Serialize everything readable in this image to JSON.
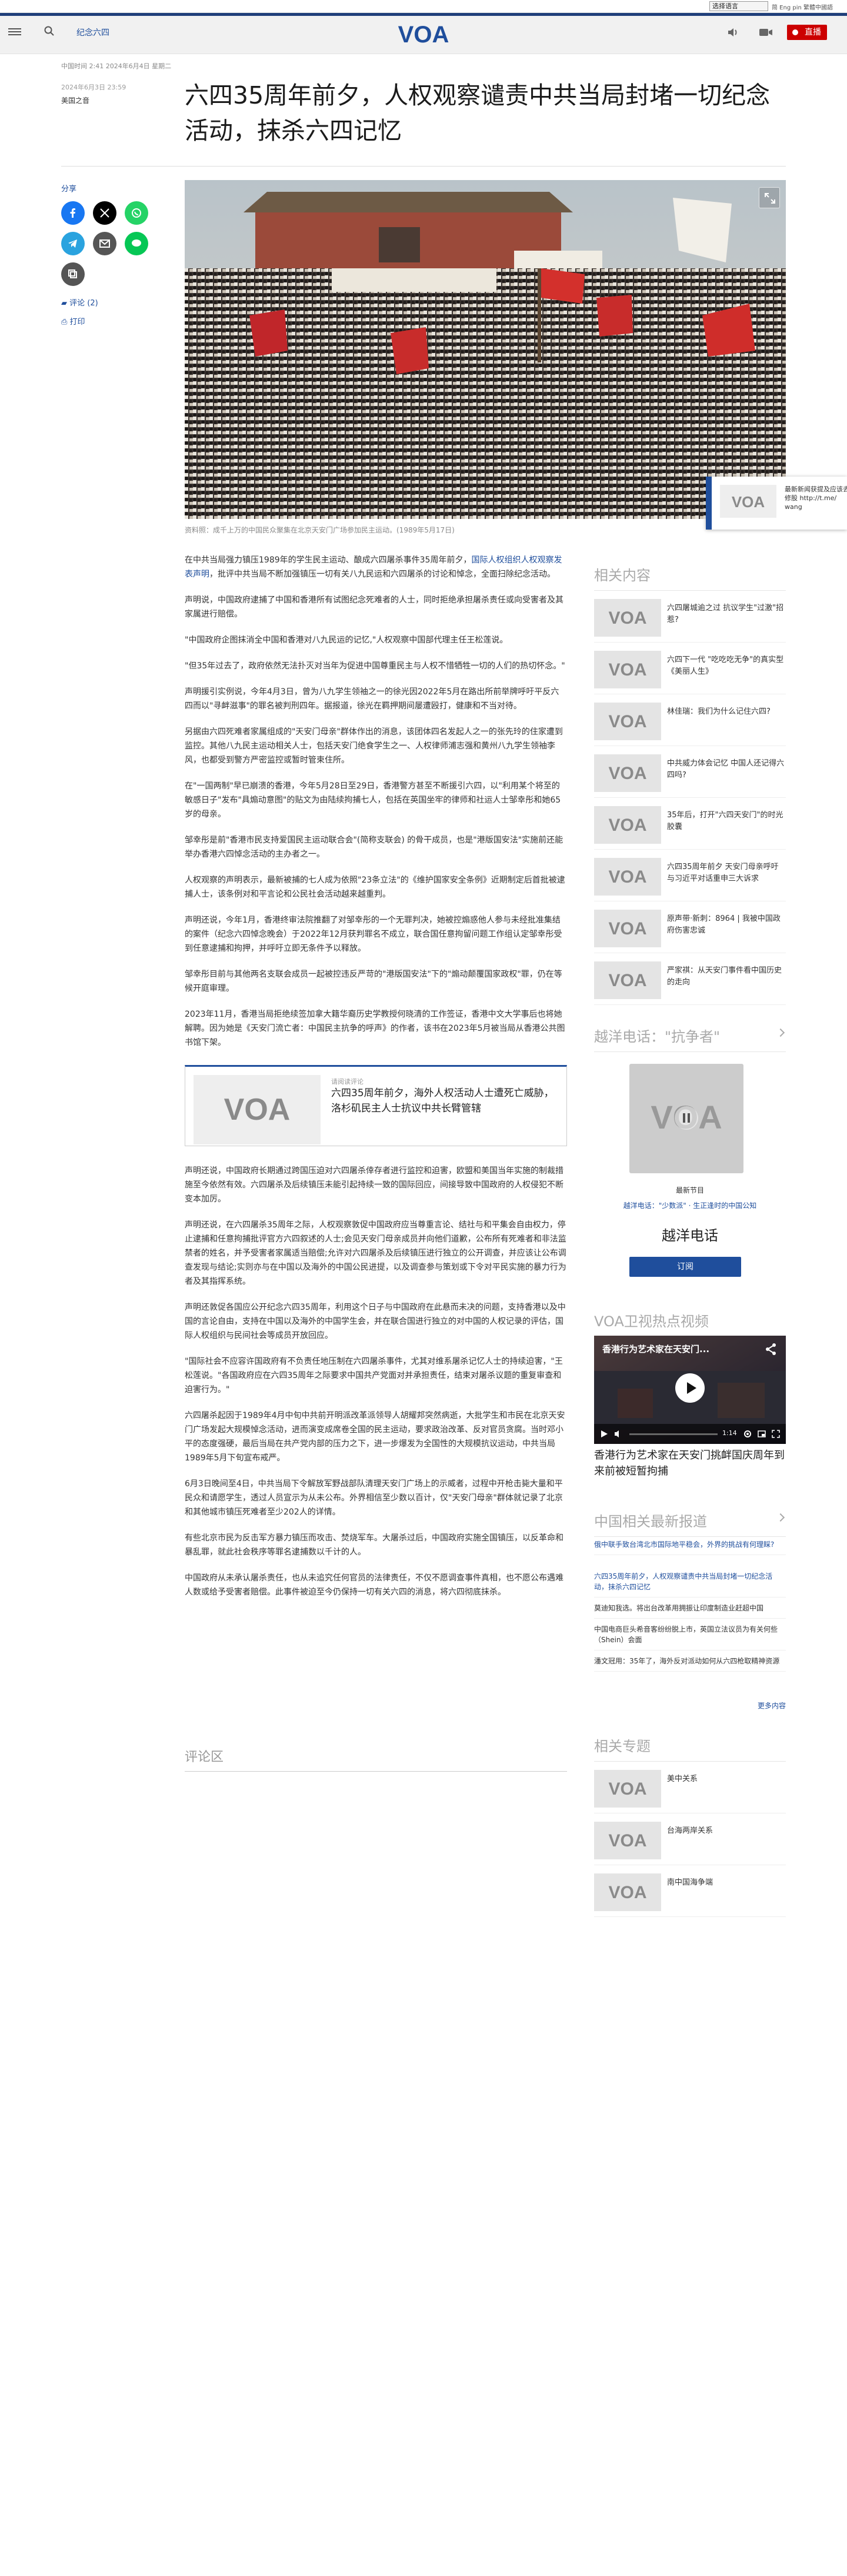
{
  "topbar": {
    "language_select": "选择语言",
    "links": "简 Eng pin  繁體中國語"
  },
  "nav": {
    "title": "纪念六四",
    "live_label": "直播",
    "logo_text": "VOA"
  },
  "article": {
    "meta": "中国时间 2:41 2024年6月4日 星期二",
    "date": "2024年6月3日 23:59",
    "category": "美国之音",
    "title": "六四35周年前夕，人权观察谴责中共当局封堵一切纪念活动，抹杀六四记忆",
    "share_label": "分享",
    "comments_label": "评论 (2)",
    "print_label": "打印",
    "caption": "资料照：成千上万的中国民众聚集在北京天安门广场参加民主运动。(1989年5月17日)",
    "p1_a": "在中共当局强力镇压1989年的学生民主运动、酿成六四屠杀事件35周年前夕，",
    "p1_link": "国际人权组织人权观察发表声明",
    "p1_b": "，批评中共当局不断加强镇压一切有关八九民运和六四屠杀的讨论和悼念，全面扫除纪念活动。",
    "p2": "声明说，中国政府逮捕了中国和香港所有试图纪念死难者的人士，同时拒绝承担屠杀责任或向受害者及其家属进行赔偿。",
    "p3": "\"中国政府企图抹消全中国和香港对八九民运的记忆,\"人权观察中国部代理主任王松莲说。",
    "p4": "\"但35年过去了，政府依然无法扑灭对当年为促进中国尊重民主与人权不惜牺牲一切的人们的热切怀念。\"",
    "p5": "声明援引实例说，今年4月3日，曾为八九学生领袖之一的徐光因2022年5月在路出所前举牌呼吁平反六四而以\"寻衅滋事\"的罪名被判刑四年。据报道，徐光在羁押期间屡遭殴打，健康和不当对待。",
    "p6": "另据由六四死难者家属组成的\"天安门母亲\"群体作出的消息，该团体四名发起人之一的张先玲的住家遭到监控。其他八九民主运动相关人士，包括天安门绝食学生之一、人权律师浦志强和黄州八九学生领袖李风，也都受到警方严密监控或暂时管束住所。",
    "p7": "在\"一国两制\"早已崩溃的香港，今年5月28日至29日，香港警方甚至不断援引六四，以\"利用某个将至的敏感日子\"发布\"具煽动意图\"的贴文为由陆续拘捕七人，包括在英国坐牢的律师和社运人士邹幸彤和她65岁的母亲。",
    "p8": "邹幸彤是前\"香港市民支持爱国民主运动联合会\"(简称支联会) 的骨干成员，也是\"港版国安法\"实施前还能举办香港六四悼念活动的主办者之一。",
    "p9": "人权观察的声明表示，最新被捕的七人成为依照\"23条立法\"的《维护国家安全条例》近期制定后首批被逮捕人士，该条例对和平言论和公民社会活动越来越重判。",
    "p10": "声明还说，今年1月，香港终审法院推翻了对邹幸彤的一个无罪判决，她被控煽惑他人参与未经批准集结的案件（纪念六四悼念晚会）于2022年12月获判罪名不成立，联合国任意拘留问题工作组认定邹幸彤受到任意逮捕和拘押，并呼吁立即无条件予以释放。",
    "p11": "邹幸彤目前与其他两名支联会成员一起被控违反严苛的\"港版国安法\"下的\"煽动颠覆国家政权\"罪，仍在等候开庭审理。",
    "p12": "2023年11月，香港当局拒绝续签加拿大籍华裔历史学教授何晓清的工作签证，香港中文大学事后也将她解聘。因为她是《天安门流亡者：中国民主抗争的呼声》的作者，该书在2023年5月被当局从香港公共图书馆下架。",
    "embed_label": "请阅读评论",
    "embed_title": "六四35周年前夕，海外人权活动人士遭死亡威胁，洛杉矶民主人士抗议中共长臂管辖",
    "p13": "声明还说，中国政府长期通过跨国压迫对六四屠杀倖存者进行监控和迫害，欧盟和美国当年实施的制裁措施至今依然有效。六四屠杀及后续镇压未能引起持续一致的国际回应，间接导致中国政府的人权侵犯不断变本加厉。",
    "p14": "声明还说，在六四屠杀35周年之际，人权观察敦促中国政府应当尊重言论、结社与和平集会自由权力，停止逮捕和任意拘捕批评官方六四叙述的人士;会见天安门母亲成员并向他们道歉，公布所有死难者和非法监禁者的姓名，并予受害者家属适当赔偿;允许对六四屠杀及后续镇压进行独立的公开调查，并应该让公布调查发现与结论;实则亦与在中国以及海外的中国公民进提，以及调查参与策划或下令对平民实施的暴力行为者及其指挥系统。",
    "p15": "声明还敦促各国应公开纪念六四35周年，利用这个日子与中国政府在此悬而未决的问题，支持香港以及中国的言论自由，支持在中国以及海外的中国学生会，并在联合国进行独立的对中国的人权记录的评估，国际人权组织与民间社会等成员开放回应。",
    "p16": "\"国际社会不应容许国政府有不负责任地压制在六四屠杀事件，尤其对维系屠杀记忆人士的持续迫害，\"王松莲说。\"各国政府应在六四35周年之际要求中国共产党面对并承担责任，结束对屠杀议题的重复审查和迫害行为。\"",
    "p17": "六四屠杀起因于1989年4月中旬中共前开明派改革派领导人胡耀邦突然病逝，大批学生和市民在北京天安门广场发起大规模悼念活动，进而演变成席卷全国的民主运动，要求政治改革、反对官员贪腐。当时邓小平的态度强硬，最后当局在共产党内部的压力之下，进一步爆发为全国性的大规模抗议运动，中共当局1989年5月下旬宣布戒严。",
    "p18": "6月3日晚间至4日，中共当局下令解放军野战部队清理天安门广场上的示威者，过程中开枪击毙大量和平民众和请愿学生，透过人员宣示为从未公布。外界相信至少数以百计，仅\"天安门母亲\"群体就记录了北京和其他城市镇压死难者至少202人的详情。",
    "p19": "有些北京市民为反击军方暴力镇压而攻击、焚烧军车。大屠杀过后，中国政府实施全国镇压，以反革命和暴乱罪，就此社会秩序等罪名逮捕数以千计的人。",
    "p20": "中国政府从未承认屠杀责任，也从未追究任何官员的法律责任，不仅不愿调查事件真相，也不愿公布遇难人数或给予受害者赔偿。此事件被迫至今仍保持一切有关六四的消息，将六四彻底抹杀。"
  },
  "comments_heading": "评论区",
  "sidebar": {
    "related_heading": "相关内容",
    "related": [
      {
        "title": "六四屠城逾之过 抗议学生\"过激\"招惹?"
      },
      {
        "title": "六四下一代 \"吃吃吃无争\"的真实型《美丽人生》"
      },
      {
        "title": "林佳瑞：我们为什么记住六四?"
      },
      {
        "title": "中共威力体会记忆 中国人还记得六四吗?"
      },
      {
        "title": "35年后，打开\"六四天安门\"的时光胶囊"
      },
      {
        "title": "六四35周年前夕 天安门母亲呼吁与习近平对话重申三大诉求"
      },
      {
        "title": "原声带·新刺：8964 | 我被中国政府伤害忠诚"
      },
      {
        "title": "严家祺：从天安门事件看中国历史的走向"
      }
    ],
    "program_heading": "越洋电话：\"抗争者\"",
    "program_label": "最新节目",
    "program_sub": "越洋电话：\"少数派\" · 生正逢时的中国公知",
    "program_name": "越洋电话",
    "subscribe_label": "订阅",
    "video_heading": "VOA卫视热点视频",
    "video_overlay": "香港行为艺术家在天安门...",
    "video_time": "1:14",
    "video_title": "香港行为艺术家在天安门挑衅国庆周年到来前被短暂拘捕",
    "china_heading": "中国相关最新报道",
    "china_news": [
      {
        "title": "俄中联手致台湾北市国际地平稳会，外界的挑战有何理睬?"
      },
      {
        "title": "六四35周年前夕，人权观察谴责中共当局封堵一切纪念活动，抹杀六四记忆"
      },
      {
        "title": "莫迪知我选。将出台改革用拥振让印度制造业赶超中国"
      },
      {
        "title": "中国电商巨头希音客纷纷脱上市，英国立法议员为有关何些（Shein）会面"
      },
      {
        "title": "潘文冠用：35年了，海外反对派动如何从六四枪取精神资源"
      }
    ],
    "more_label": "更多内容",
    "topics_heading": "相关专题",
    "topics": [
      {
        "title": "美中关系"
      },
      {
        "title": "台海两岸关系"
      },
      {
        "title": "南中国海争端"
      }
    ]
  },
  "popup": {
    "text": "最新新闻获提及应该去修股 http://t.me/ wang"
  },
  "colors": {
    "brand_blue": "#1f4e9c",
    "live_red": "#c00000",
    "nav_bg": "#f1f1f1"
  }
}
